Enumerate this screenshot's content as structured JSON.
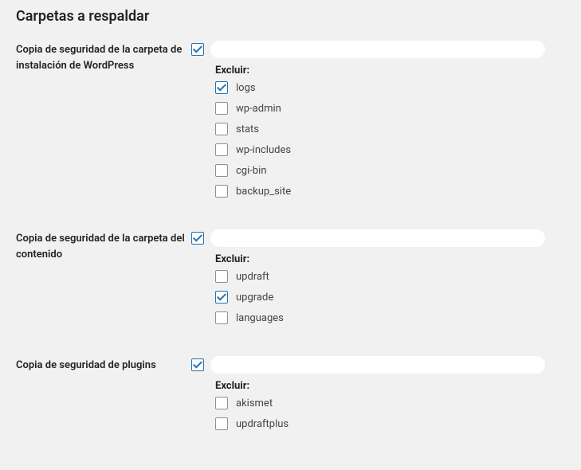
{
  "heading": "Carpetas a respaldar",
  "sections": [
    {
      "label": "Copia de seguridad de la carpeta de instalación de WordPress",
      "mainChecked": true,
      "excludeLabel": "Excluir:",
      "items": [
        {
          "label": "logs",
          "checked": true
        },
        {
          "label": "wp-admin",
          "checked": false
        },
        {
          "label": "stats",
          "checked": false
        },
        {
          "label": "wp-includes",
          "checked": false
        },
        {
          "label": "cgi-bin",
          "checked": false
        },
        {
          "label": "backup_site",
          "checked": false
        }
      ]
    },
    {
      "label": "Copia de seguridad de la carpeta del contenido",
      "mainChecked": true,
      "excludeLabel": "Excluir:",
      "items": [
        {
          "label": "updraft",
          "checked": false
        },
        {
          "label": "upgrade",
          "checked": true
        },
        {
          "label": "languages",
          "checked": false
        }
      ]
    },
    {
      "label": "Copia de seguridad de plugins",
      "mainChecked": true,
      "excludeLabel": "Excluir:",
      "items": [
        {
          "label": "akismet",
          "checked": false
        },
        {
          "label": "updraftplus",
          "checked": false
        }
      ]
    }
  ]
}
